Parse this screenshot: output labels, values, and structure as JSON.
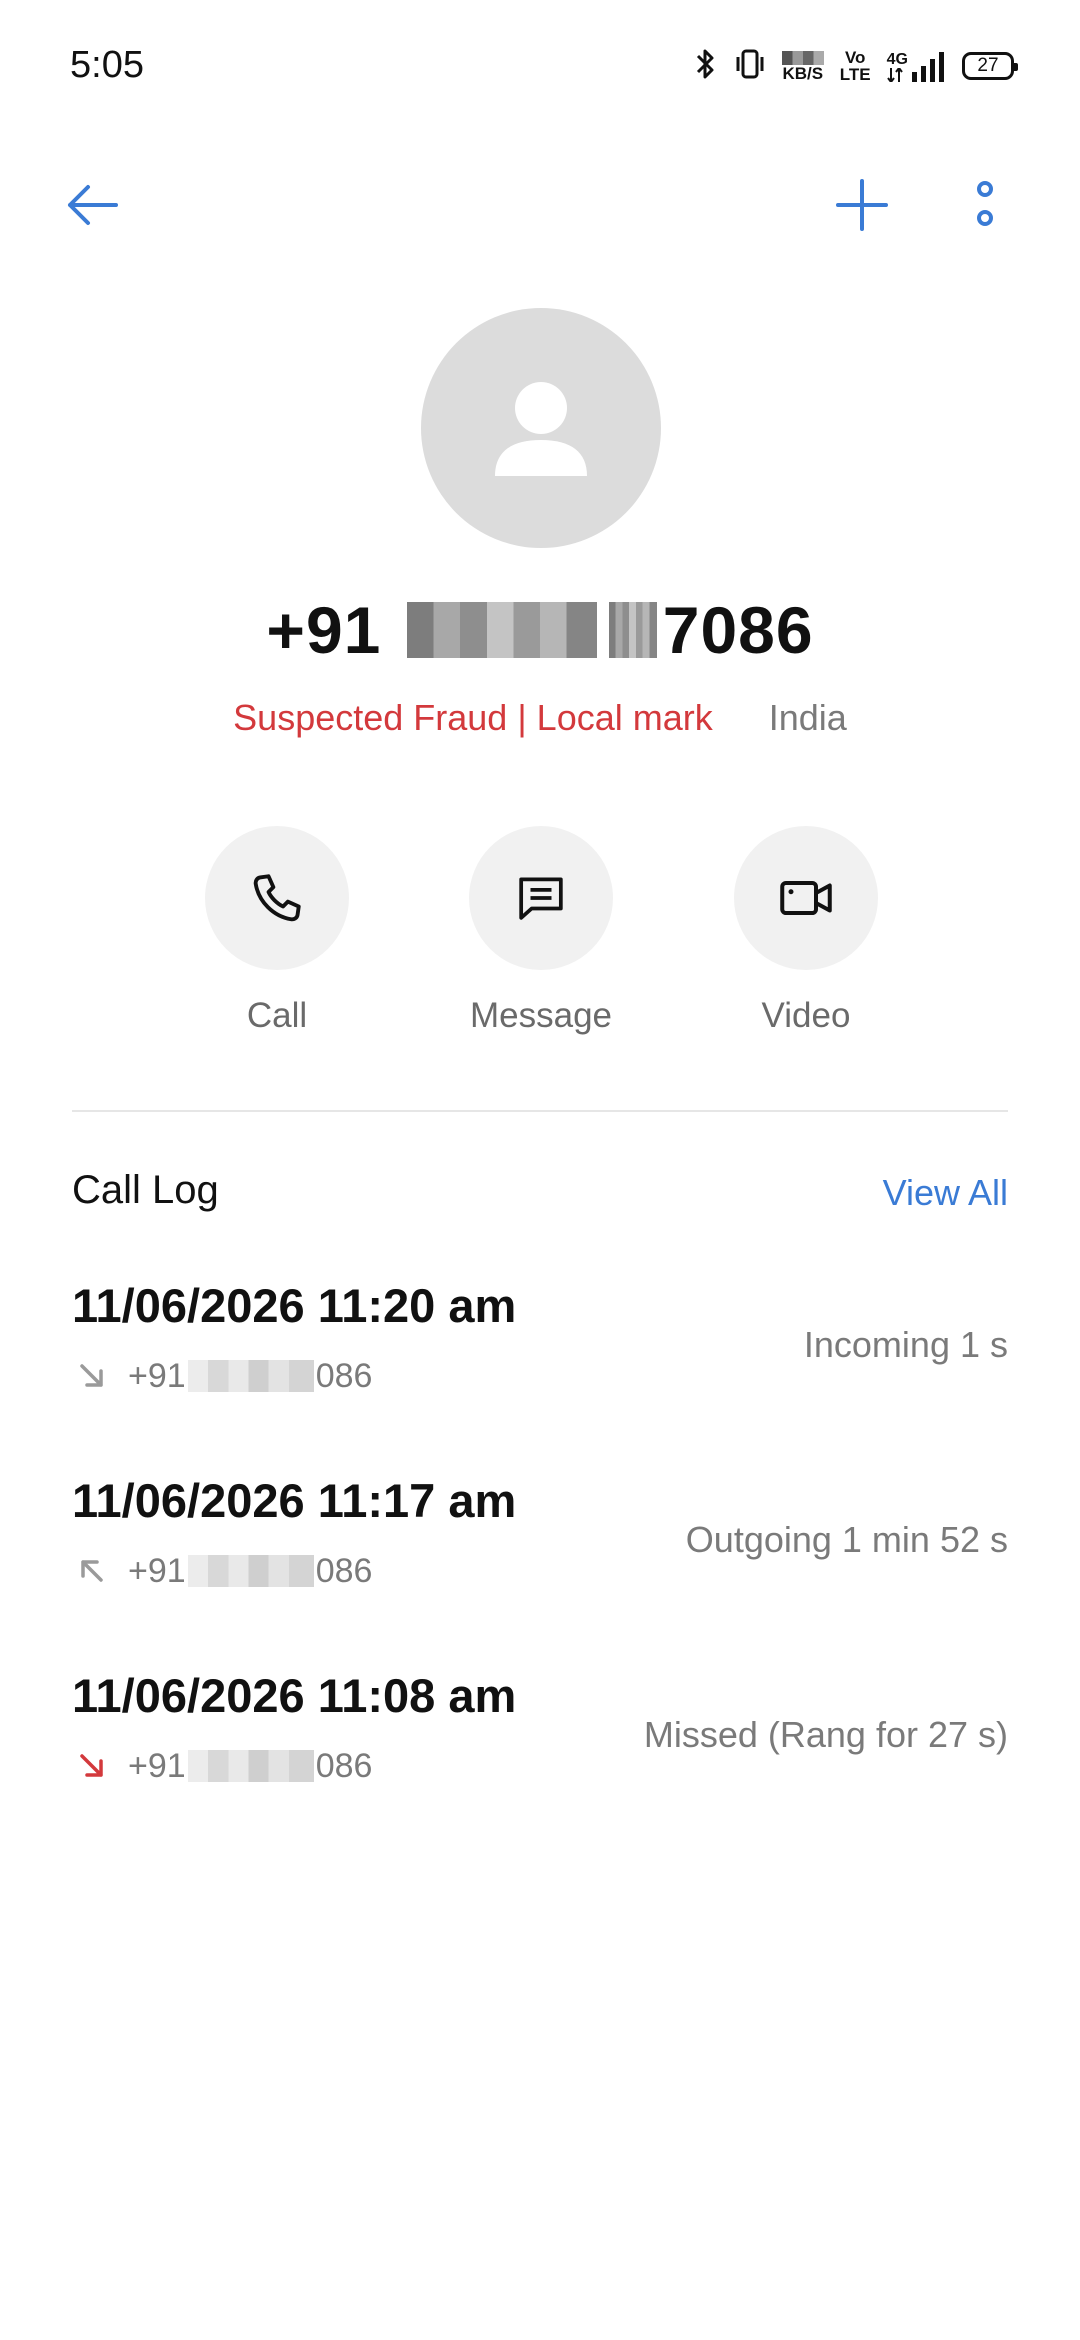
{
  "status_bar": {
    "time": "5:05",
    "net_speed_unit": "KB/S",
    "volte_top": "Vo",
    "volte_bottom": "LTE",
    "network": "4G",
    "battery": "27"
  },
  "nav": {
    "back_icon": "arrow-left-icon",
    "add_icon": "plus-icon",
    "more_icon": "more-vertical-icon",
    "accent": "#3a7bd5"
  },
  "contact": {
    "number_prefix": "+91",
    "number_suffix": "7086",
    "fraud_tag": "Suspected Fraud | Local mark",
    "region": "India",
    "fraud_color": "#d3393c"
  },
  "actions": [
    {
      "label": "Call",
      "icon": "phone-icon"
    },
    {
      "label": "Message",
      "icon": "message-icon"
    },
    {
      "label": "Video",
      "icon": "video-camera-icon"
    }
  ],
  "call_log": {
    "title": "Call Log",
    "view_all": "View All",
    "entries": [
      {
        "datetime": "11/06/2026 11:20 am",
        "number_prefix": "+91",
        "number_suffix": "086",
        "status": "Incoming  1 s",
        "direction": "incoming"
      },
      {
        "datetime": "11/06/2026 11:17 am",
        "number_prefix": "+91",
        "number_suffix": "086",
        "status": "Outgoing  1  min 52 s",
        "direction": "outgoing"
      },
      {
        "datetime": "11/06/2026 11:08 am",
        "number_prefix": "+91",
        "number_suffix": "086",
        "status": "Missed (Rang for 27 s)",
        "direction": "missed"
      }
    ]
  }
}
